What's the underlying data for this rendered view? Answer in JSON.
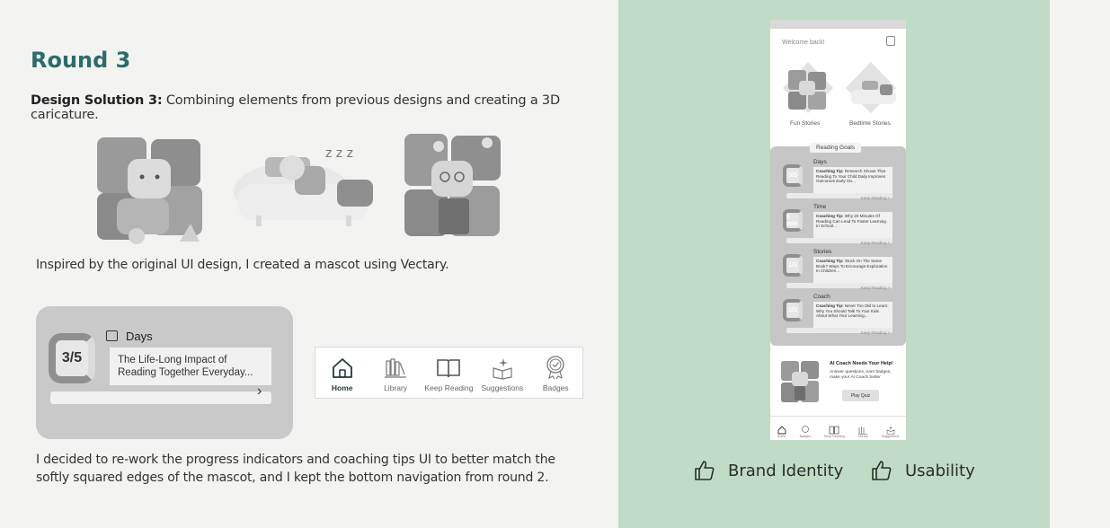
{
  "heading": "Round 3",
  "solution": {
    "label": "Design Solution 3:",
    "text": " Combining elements from previous designs and creating a 3D caricature."
  },
  "caption1": "Inspired by the original UI design,  I created a mascot using Vectary.",
  "progress_card": {
    "value": "3/5",
    "label": "Days",
    "tip": "The Life-Long Impact of Reading Together Everyday..."
  },
  "bottom_nav": [
    {
      "label": "Home",
      "icon": "home-icon",
      "active": true
    },
    {
      "label": "Library",
      "icon": "library-icon"
    },
    {
      "label": "Keep Reading",
      "icon": "book-icon"
    },
    {
      "label": "Suggestions",
      "icon": "sparkle-book-icon"
    },
    {
      "label": "Badges",
      "icon": "badge-icon"
    }
  ],
  "caption2": "I decided to re-work the progress indicators and coaching tips UI to better match the softly squared edges of the mascot, and  I kept the bottom navigation from round 2.",
  "phone": {
    "welcome": "Welcome back!",
    "cards": [
      "Fun Stories",
      "Bedtime Stories"
    ],
    "reading_goals": "Reading Goals",
    "goals": [
      {
        "value": "3/5",
        "label": "Days",
        "tip_title": "Coaching Tip:",
        "tip": "Research Shows That Reading To Your Child Daily Improves Outcomes Early On...",
        "link": "Keep Reading >"
      },
      {
        "value": "5 min",
        "label": "Time",
        "tip_title": "Coaching Tip:",
        "tip": "Why 20 Minutes Of Reading Can Lead To Faster Learning In School...",
        "link": "Keep Reading >"
      },
      {
        "value": "1/3",
        "label": "Stories",
        "tip_title": "Coaching Tip:",
        "tip": "Stuck On The Same Book? Ways To Encourage Exploration In Children...",
        "link": "Keep Reading >"
      },
      {
        "value": "1/3",
        "label": "Coach",
        "tip_title": "Coaching Tip:",
        "tip": "Never Too Old to Learn: Why You Should Talk To Your Kids About What Your Learning...",
        "link": "Keep Reading >"
      }
    ],
    "coach": {
      "title": "AI Coach Needs Your Help!",
      "sub": "Answer questions, earn badges, make your AI Coach better",
      "button": "Play Quiz"
    },
    "nav": [
      "Home",
      "Badges",
      "Keep Reading",
      "Library",
      "Suggestions"
    ]
  },
  "ratings": [
    "Brand Identity",
    "Usability"
  ],
  "colors": {
    "accent": "#2a6d6a",
    "panel": "#c0dcc6",
    "card": "#c9c9c9"
  }
}
